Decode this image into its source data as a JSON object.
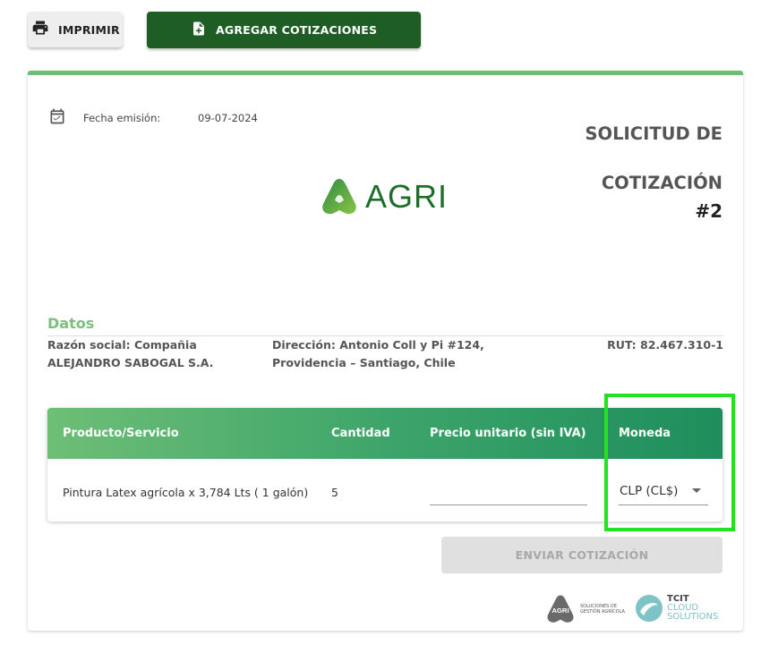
{
  "toolbar": {
    "print_label": "IMPRIMIR",
    "add_label": "AGREGAR COTIZACIONES"
  },
  "header": {
    "date_label": "Fecha emisión:",
    "date_value": "09-07-2024",
    "title": "SOLICITUD DE COTIZACIÓN",
    "number": "#2",
    "logo_text": "AGRI"
  },
  "datos": {
    "section_title": "Datos",
    "razon_social": "Razón social: Compañia ALEJANDRO SABOGAL S.A.",
    "direccion": "Dirección: Antonio Coll y Pi #124, Providencia – Santiago, Chile",
    "rut": "RUT: 82.467.310-1"
  },
  "table": {
    "columns": [
      "Producto/Servicio",
      "Cantidad",
      "Precio unitario (sin IVA)",
      "Moneda"
    ],
    "rows": [
      {
        "producto": "Pintura Latex agrícola x 3,784 Lts ( 1 galón)",
        "cantidad": "5",
        "precio": "",
        "moneda": "CLP (CL$)"
      }
    ]
  },
  "actions": {
    "send_label": "ENVIAR COTIZACIÓN"
  },
  "footer": {
    "agri_logo_text": "AGRI",
    "agri_subtitle": "SOLUCIONES DE GESTIÓN AGRÍCOLA",
    "tcit_line1": "TCIT",
    "tcit_line2": "CLOUD",
    "tcit_line3": "SOLUTIONS"
  },
  "colors": {
    "primary_dark_green": "#1e5e25",
    "accent_green": "#6dbd74",
    "highlight": "#22e222"
  },
  "icons": [
    "printer-icon",
    "add-document-icon",
    "calendar-icon",
    "dropdown-caret-icon"
  ]
}
